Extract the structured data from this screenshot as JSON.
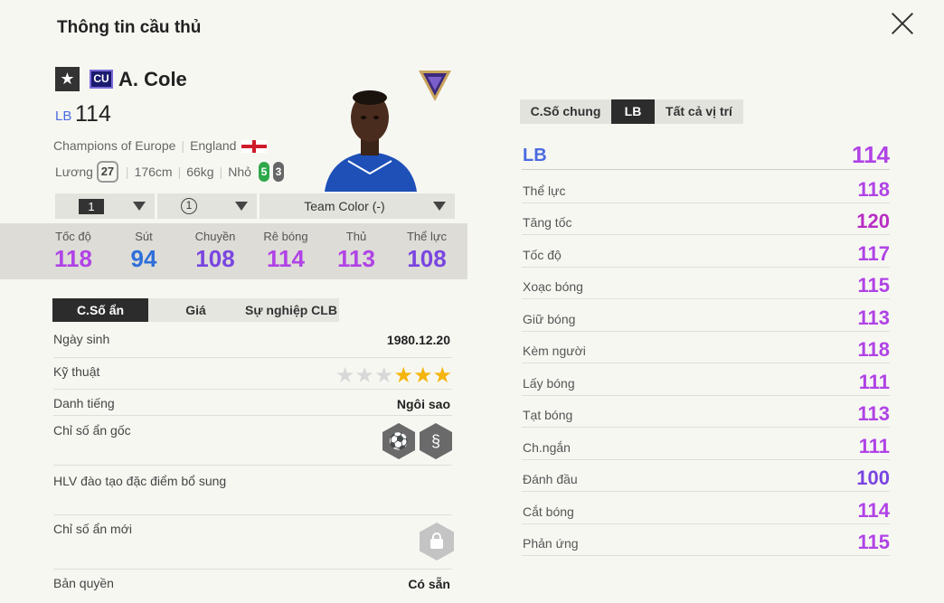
{
  "header": {
    "title": "Thông tin cầu thủ",
    "close_icon": "close-icon"
  },
  "player": {
    "name": "A. Cole",
    "season_badge": "CU",
    "position": "LB",
    "ovr": "114",
    "team": "Champions of Europe",
    "nation": "England",
    "salary_label": "Lương",
    "salary": "27",
    "height": "176cm",
    "weight": "66kg",
    "body": "Nhỏ",
    "left_foot": "5",
    "right_foot": "3"
  },
  "dropdowns": {
    "level": "1",
    "grade": "1",
    "team_color": "Team Color (-)"
  },
  "stats": [
    {
      "label": "Tốc độ",
      "value": "118",
      "color": "#b043e6"
    },
    {
      "label": "Sút",
      "value": "94",
      "color": "#2e6fd9"
    },
    {
      "label": "Chuyền",
      "value": "108",
      "color": "#7a45e0"
    },
    {
      "label": "Rê bóng",
      "value": "114",
      "color": "#b043e6"
    },
    {
      "label": "Thủ",
      "value": "113",
      "color": "#b043e6"
    },
    {
      "label": "Thể lực",
      "value": "108",
      "color": "#7a45e0"
    }
  ],
  "left_tabs": [
    "C.Số ẩn",
    "Giá",
    "Sự nghiệp CLB"
  ],
  "info": {
    "birth_label": "Ngày sinh",
    "birth": "1980.12.20",
    "skill_label": "Kỹ thuật",
    "skill_stars": 3,
    "skill_max": 6,
    "fame_label": "Danh tiếng",
    "fame": "Ngôi sao",
    "traits_label": "Chỉ số ẩn gốc",
    "coach_label": "HLV đào tạo đặc điểm bổ sung",
    "new_traits_label": "Chỉ số ẩn mới",
    "license_label": "Bản quyền",
    "license": "Có sẵn"
  },
  "right_tabs": [
    "C.Số chung",
    "LB",
    "Tất cả vị trí"
  ],
  "detail": {
    "pos": "LB",
    "pos_value": "114",
    "rows": [
      {
        "label": "Thể lực",
        "value": "118",
        "color": "#b043e6"
      },
      {
        "label": "Tăng tốc",
        "value": "120",
        "color": "#b82ec4"
      },
      {
        "label": "Tốc độ",
        "value": "117",
        "color": "#b043e6"
      },
      {
        "label": "Xoạc bóng",
        "value": "115",
        "color": "#b043e6"
      },
      {
        "label": "Giữ bóng",
        "value": "113",
        "color": "#b043e6"
      },
      {
        "label": "Kèm người",
        "value": "118",
        "color": "#b043e6"
      },
      {
        "label": "Lấy bóng",
        "value": "111",
        "color": "#b043e6"
      },
      {
        "label": "Tạt bóng",
        "value": "113",
        "color": "#b043e6"
      },
      {
        "label": "Ch.ngắn",
        "value": "111",
        "color": "#b043e6"
      },
      {
        "label": "Đánh đầu",
        "value": "100",
        "color": "#7a45e0"
      },
      {
        "label": "Cắt bóng",
        "value": "114",
        "color": "#b043e6"
      },
      {
        "label": "Phản ứng",
        "value": "115",
        "color": "#b043e6"
      }
    ]
  }
}
